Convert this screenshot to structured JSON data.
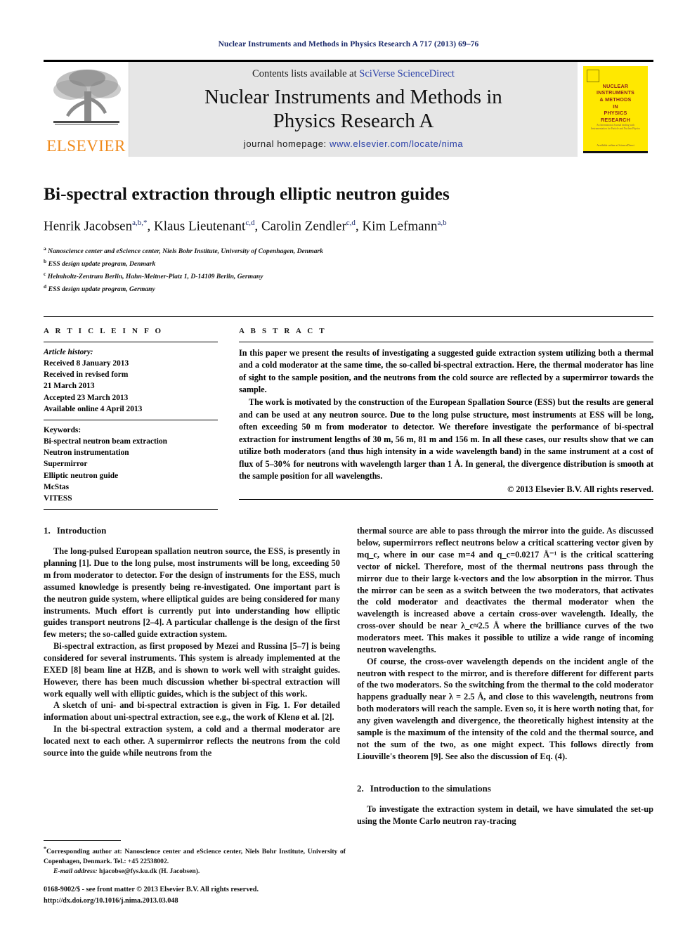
{
  "running_head": "Nuclear Instruments and Methods in Physics Research A 717 (2013) 69–76",
  "masthead": {
    "publisher_word": "ELSEVIER",
    "contents_prefix": "Contents lists available at ",
    "contents_link": "SciVerse ScienceDirect",
    "journal_title_line1": "Nuclear Instruments and Methods in",
    "journal_title_line2": "Physics Research A",
    "homepage_prefix": "journal homepage: ",
    "homepage_link": "www.elsevier.com/locate/nima",
    "cover": {
      "title": "NUCLEAR\nINSTRUMENTS\n& METHODS\nIN\nPHYSICS\nRESEARCH",
      "subtitle": "An International Journal dealing with\nInstrumentation for Particle and Nuclear Physics",
      "footer": "Available online at ScienceDirect"
    }
  },
  "article": {
    "title": "Bi-spectral extraction through elliptic neutron guides",
    "authors": [
      {
        "name": "Henrik Jacobsen",
        "sup": "a,b,*"
      },
      {
        "name": "Klaus Lieutenant",
        "sup": "c,d"
      },
      {
        "name": "Carolin Zendler",
        "sup": "c,d"
      },
      {
        "name": "Kim Lefmann",
        "sup": "a,b"
      }
    ],
    "affiliations": [
      {
        "marker": "a",
        "text": "Nanoscience center and eScience center, Niels Bohr Institute, University of Copenhagen, Denmark"
      },
      {
        "marker": "b",
        "text": "ESS design update program, Denmark"
      },
      {
        "marker": "c",
        "text": "Helmholtz-Zentrum Berlin, Hahn-Meitner-Platz 1, D-14109 Berlin, Germany"
      },
      {
        "marker": "d",
        "text": "ESS design update program, Germany"
      }
    ]
  },
  "article_info": {
    "heading": "A R T I C L E   I N F O",
    "history_label": "Article history:",
    "history": [
      "Received 8 January 2013",
      "Received in revised form",
      "21 March 2013",
      "Accepted 23 March 2013",
      "Available online 4 April 2013"
    ],
    "keywords_label": "Keywords:",
    "keywords": [
      "Bi-spectral neutron beam extraction",
      "Neutron instrumentation",
      "Supermirror",
      "Elliptic neutron guide",
      "McStas",
      "VITESS"
    ]
  },
  "abstract": {
    "heading": "A B S T R A C T",
    "paragraph1": "In this paper we present the results of investigating a suggested guide extraction system utilizing both a thermal and a cold moderator at the same time, the so-called bi-spectral extraction. Here, the thermal moderator has line of sight to the sample position, and the neutrons from the cold source are reflected by a supermirror towards the sample.",
    "paragraph2": "The work is motivated by the construction of the European Spallation Source (ESS) but the results are general and can be used at any neutron source. Due to the long pulse structure, most instruments at ESS will be long, often exceeding 50 m from moderator to detector. We therefore investigate the performance of bi-spectral extraction for instrument lengths of 30 m, 56 m, 81 m and 156 m. In all these cases, our results show that we can utilize both moderators (and thus high intensity in a wide wavelength band) in the same instrument at a cost of flux of 5–30% for neutrons with wavelength larger than 1 Å. In general, the divergence distribution is smooth at the sample position for all wavelengths.",
    "copyright": "© 2013 Elsevier B.V. All rights reserved."
  },
  "body": {
    "section1": {
      "number": "1.",
      "title": "Introduction",
      "paragraphs": [
        "The long-pulsed European spallation neutron source, the ESS, is presently in planning [1]. Due to the long pulse, most instruments will be long, exceeding 50 m from moderator to detector. For the design of instruments for the ESS, much assumed knowledge is presently being re-investigated. One important part is the neutron guide system, where elliptical guides are being considered for many instruments. Much effort is currently put into understanding how elliptic guides transport neutrons [2–4]. A particular challenge is the design of the first few meters; the so-called guide extraction system.",
        "Bi-spectral extraction, as first proposed by Mezei and Russina [5–7] is being considered for several instruments. This system is already implemented at the EXED [8] beam line at HZB, and is shown to work well with straight guides. However, there has been much discussion whether bi-spectral extraction will work equally well with elliptic guides, which is the subject of this work.",
        "A sketch of uni- and bi-spectral extraction is given in Fig. 1. For detailed information about uni-spectral extraction, see e.g., the work of Klenø et al. [2].",
        "In the bi-spectral extraction system, a cold and a thermal moderator are located next to each other. A supermirror reflects the neutrons from the cold source into the guide while neutrons from the"
      ]
    },
    "right_column": {
      "continuation": "thermal source are able to pass through the mirror into the guide. As discussed below, supermirrors reflect neutrons below a critical scattering vector given by mq_c, where in our case m=4 and q_c=0.0217 Å⁻¹ is the critical scattering vector of nickel. Therefore, most of the thermal neutrons pass through the mirror due to their large k-vectors and the low absorption in the mirror. Thus the mirror can be seen as a switch between the two moderators, that activates the cold moderator and deactivates the thermal moderator when the wavelength is increased above a certain cross-over wavelength. Ideally, the cross-over should be near λ_c≈2.5 Å where the brilliance curves of the two moderators meet. This makes it possible to utilize a wide range of incoming neutron wavelengths.",
      "paragraph2": "Of course, the cross-over wavelength depends on the incident angle of the neutron with respect to the mirror, and is therefore different for different parts of the two moderators. So the switching from the thermal to the cold moderator happens gradually near λ = 2.5 Å, and close to this wavelength, neutrons from both moderators will reach the sample. Even so, it is here worth noting that, for any given wavelength and divergence, the theoretically highest intensity at the sample is the maximum of the intensity of the cold and the thermal source, and not the sum of the two, as one might expect. This follows directly from Liouville's theorem [9]. See also the discussion of Eq. (4)."
    },
    "section2": {
      "number": "2.",
      "title": "Introduction to the simulations",
      "paragraph1": "To investigate the extraction system in detail, we have simulated the set-up using the Monte Carlo neutron ray-tracing"
    }
  },
  "footnotes": {
    "corresponding": "Corresponding author at: Nanoscience center and eScience center, Niels Bohr Institute, University of Copenhagen, Denmark. Tel.: +45 22538002.",
    "email_label": "E-mail address:",
    "email_value": "hjacobse@fys.ku.dk (H. Jacobsen).",
    "issn_line": "0168-9002/$ - see front matter © 2013 Elsevier B.V. All rights reserved.",
    "doi_line": "http://dx.doi.org/10.1016/j.nima.2013.03.048"
  },
  "colors": {
    "running_head": "#1b2a6b",
    "link": "#2b41a8",
    "citation": "#1b3d8f",
    "elsevier_orange": "#f08a1b",
    "cover_yellow": "#ffe800",
    "cover_text": "#8f1f1f",
    "masthead_grey": "#e6e6e6"
  }
}
